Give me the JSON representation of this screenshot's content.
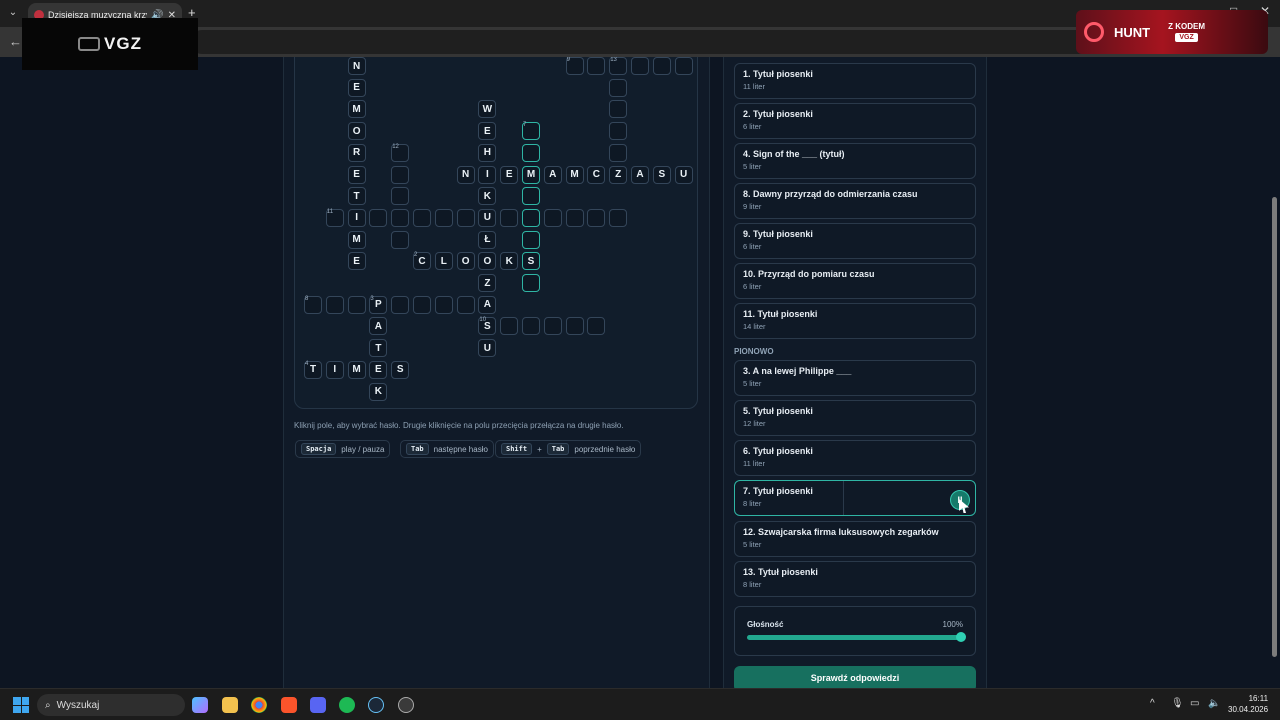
{
  "browser": {
    "tab_title": "Dzisiejsza muzyczna krzyżówka",
    "new_tab": "+",
    "minimize": "–",
    "maximize": "□",
    "close": "✕",
    "back": "←"
  },
  "ads": {
    "vgz": "VGZ",
    "hunt": "HUNT",
    "z_kodem": "Z KODEM",
    "code": "VGZ"
  },
  "crossword": {
    "cells": [
      {
        "c": 2,
        "r": 0,
        "ch": "N"
      },
      {
        "c": 2,
        "r": 1,
        "ch": "E"
      },
      {
        "c": 2,
        "r": 2,
        "ch": "M"
      },
      {
        "c": 2,
        "r": 3,
        "ch": "O"
      },
      {
        "c": 2,
        "r": 4,
        "ch": "R"
      },
      {
        "c": 2,
        "r": 5,
        "ch": "E"
      },
      {
        "c": 2,
        "r": 6,
        "ch": "T"
      },
      {
        "c": 2,
        "r": 7,
        "ch": "I"
      },
      {
        "c": 2,
        "r": 8,
        "ch": "M"
      },
      {
        "c": 2,
        "r": 9,
        "ch": "E"
      },
      {
        "c": 12,
        "r": 0,
        "ch": "",
        "n": "9"
      },
      {
        "c": 13,
        "r": 0,
        "ch": ""
      },
      {
        "c": 14,
        "r": 0,
        "ch": "",
        "n": "13"
      },
      {
        "c": 15,
        "r": 0,
        "ch": ""
      },
      {
        "c": 16,
        "r": 0,
        "ch": ""
      },
      {
        "c": 17,
        "r": 0,
        "ch": ""
      },
      {
        "c": 14,
        "r": 1,
        "ch": ""
      },
      {
        "c": 14,
        "r": 2,
        "ch": ""
      },
      {
        "c": 14,
        "r": 3,
        "ch": ""
      },
      {
        "c": 14,
        "r": 4,
        "ch": ""
      },
      {
        "c": 8,
        "r": 2,
        "ch": "W"
      },
      {
        "c": 8,
        "r": 3,
        "ch": "E"
      },
      {
        "c": 8,
        "r": 4,
        "ch": "H"
      },
      {
        "c": 8,
        "r": 5,
        "ch": "I"
      },
      {
        "c": 8,
        "r": 6,
        "ch": "K"
      },
      {
        "c": 8,
        "r": 7,
        "ch": "U"
      },
      {
        "c": 8,
        "r": 8,
        "ch": "Ł"
      },
      {
        "c": 8,
        "r": 9,
        "ch": "O"
      },
      {
        "c": 8,
        "r": 10,
        "ch": "Z"
      },
      {
        "c": 8,
        "r": 11,
        "ch": "A"
      },
      {
        "c": 8,
        "r": 12,
        "ch": "S",
        "n": "10"
      },
      {
        "c": 8,
        "r": 13,
        "ch": "U"
      },
      {
        "c": 10,
        "r": 3,
        "ch": "",
        "n": "7",
        "hl": 1
      },
      {
        "c": 10,
        "r": 4,
        "ch": "",
        "hl": 1
      },
      {
        "c": 10,
        "r": 5,
        "ch": "M",
        "hl": 1
      },
      {
        "c": 10,
        "r": 6,
        "ch": "",
        "hl": 1
      },
      {
        "c": 10,
        "r": 7,
        "ch": "",
        "hl": 1
      },
      {
        "c": 10,
        "r": 8,
        "ch": "",
        "hl": 1
      },
      {
        "c": 10,
        "r": 9,
        "ch": "S",
        "hl": 1
      },
      {
        "c": 10,
        "r": 10,
        "ch": "",
        "hl": 1
      },
      {
        "c": 4,
        "r": 4,
        "ch": "",
        "n": "12"
      },
      {
        "c": 4,
        "r": 5,
        "ch": ""
      },
      {
        "c": 4,
        "r": 6,
        "ch": ""
      },
      {
        "c": 4,
        "r": 7,
        "ch": ""
      },
      {
        "c": 4,
        "r": 8,
        "ch": ""
      },
      {
        "c": 7,
        "r": 5,
        "ch": "N"
      },
      {
        "c": 9,
        "r": 5,
        "ch": "E"
      },
      {
        "c": 11,
        "r": 5,
        "ch": "A"
      },
      {
        "c": 12,
        "r": 5,
        "ch": "M"
      },
      {
        "c": 13,
        "r": 5,
        "ch": "C"
      },
      {
        "c": 14,
        "r": 5,
        "ch": "Z"
      },
      {
        "c": 15,
        "r": 5,
        "ch": "A"
      },
      {
        "c": 16,
        "r": 5,
        "ch": "S"
      },
      {
        "c": 17,
        "r": 5,
        "ch": "U"
      },
      {
        "c": 1,
        "r": 7,
        "ch": "",
        "n": "11"
      },
      {
        "c": 3,
        "r": 7,
        "ch": ""
      },
      {
        "c": 5,
        "r": 7,
        "ch": ""
      },
      {
        "c": 6,
        "r": 7,
        "ch": ""
      },
      {
        "c": 7,
        "r": 7,
        "ch": ""
      },
      {
        "c": 9,
        "r": 7,
        "ch": ""
      },
      {
        "c": 11,
        "r": 7,
        "ch": ""
      },
      {
        "c": 12,
        "r": 7,
        "ch": ""
      },
      {
        "c": 13,
        "r": 7,
        "ch": ""
      },
      {
        "c": 14,
        "r": 7,
        "ch": ""
      },
      {
        "c": 5,
        "r": 9,
        "ch": "C",
        "n": "2"
      },
      {
        "c": 6,
        "r": 9,
        "ch": "L"
      },
      {
        "c": 7,
        "r": 9,
        "ch": "O"
      },
      {
        "c": 9,
        "r": 9,
        "ch": "K"
      },
      {
        "c": 0,
        "r": 11,
        "ch": "",
        "n": "8"
      },
      {
        "c": 1,
        "r": 11,
        "ch": ""
      },
      {
        "c": 2,
        "r": 11,
        "ch": ""
      },
      {
        "c": 3,
        "r": 11,
        "ch": "P",
        "n": "3"
      },
      {
        "c": 4,
        "r": 11,
        "ch": ""
      },
      {
        "c": 5,
        "r": 11,
        "ch": ""
      },
      {
        "c": 6,
        "r": 11,
        "ch": ""
      },
      {
        "c": 7,
        "r": 11,
        "ch": ""
      },
      {
        "c": 3,
        "r": 12,
        "ch": "A"
      },
      {
        "c": 3,
        "r": 13,
        "ch": "T"
      },
      {
        "c": 9,
        "r": 12,
        "ch": ""
      },
      {
        "c": 10,
        "r": 12,
        "ch": ""
      },
      {
        "c": 11,
        "r": 12,
        "ch": ""
      },
      {
        "c": 12,
        "r": 12,
        "ch": ""
      },
      {
        "c": 13,
        "r": 12,
        "ch": ""
      },
      {
        "c": 0,
        "r": 14,
        "ch": "T",
        "n": "4"
      },
      {
        "c": 1,
        "r": 14,
        "ch": "I"
      },
      {
        "c": 2,
        "r": 14,
        "ch": "M"
      },
      {
        "c": 3,
        "r": 14,
        "ch": "E"
      },
      {
        "c": 4,
        "r": 14,
        "ch": "S"
      },
      {
        "c": 3,
        "r": 15,
        "ch": "K"
      }
    ]
  },
  "instructions": "Kliknij pole, aby wybrać hasło. Drugie kliknięcie na polu przecięcia przełącza na drugie hasło.",
  "shortcuts": [
    {
      "keys": [
        "Spacja"
      ],
      "desc": "play / pauza"
    },
    {
      "keys": [
        "Tab"
      ],
      "desc": "następne hasło"
    },
    {
      "keys": [
        "Shift",
        "Tab"
      ],
      "desc": "poprzednie hasło"
    }
  ],
  "shortcut_plus": "+",
  "clues_across": [
    {
      "title": "1. Tytuł piosenki",
      "sub": "11 liter"
    },
    {
      "title": "2. Tytuł piosenki",
      "sub": "6 liter"
    },
    {
      "title": "4. Sign of the ___ (tytuł)",
      "sub": "5 liter"
    },
    {
      "title": "8. Dawny przyrząd do odmierzania czasu",
      "sub": "9 liter"
    },
    {
      "title": "9. Tytuł piosenki",
      "sub": "6 liter"
    },
    {
      "title": "10. Przyrząd do pomiaru czasu",
      "sub": "6 liter"
    },
    {
      "title": "11. Tytuł piosenki",
      "sub": "14 liter"
    }
  ],
  "down_header": "PIONOWO",
  "clues_down": [
    {
      "title": "3. A na lewej Philippe ___",
      "sub": "5 liter"
    },
    {
      "title": "5. Tytuł piosenki",
      "sub": "12 liter"
    },
    {
      "title": "6. Tytuł piosenki",
      "sub": "11 liter"
    },
    {
      "title": "7. Tytuł piosenki",
      "sub": "8 liter",
      "active": true
    },
    {
      "title": "12. Szwajcarska firma luksusowych zegarków",
      "sub": "5 liter"
    },
    {
      "title": "13. Tytuł piosenki",
      "sub": "8 liter"
    }
  ],
  "pause_icon": "II",
  "volume": {
    "label": "Głośność",
    "value": 100,
    "display": "100%"
  },
  "submit": "Sprawdź odpowiedzi",
  "taskbar": {
    "search": "Wyszukaj",
    "time": "16:11",
    "date": "30.04.2026"
  }
}
